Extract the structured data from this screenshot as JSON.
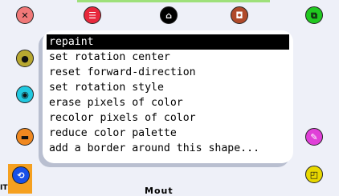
{
  "menu": {
    "items": [
      {
        "label": "repaint"
      },
      {
        "label": "set rotation center"
      },
      {
        "label": "reset forward-direction"
      },
      {
        "label": "set rotation style"
      },
      {
        "label": "erase pixels of color"
      },
      {
        "label": "recolor pixels of color"
      },
      {
        "label": "reduce color palette"
      },
      {
        "label": "add a border around this shape..."
      }
    ]
  },
  "halo": {
    "delete": {
      "glyph": "✕",
      "color": "#f07878"
    },
    "menu": {
      "glyph": "☰",
      "color": "#e8283c"
    },
    "pickup": {
      "glyph": "⌂",
      "color": "#000000"
    },
    "move": {
      "glyph": "◘",
      "color": "#b04a2a"
    },
    "duplicate": {
      "glyph": "⧉",
      "color": "#20c820"
    },
    "debug": {
      "glyph": "●",
      "color": "#b8a830"
    },
    "view": {
      "glyph": "◉",
      "color": "#20c8e0"
    },
    "collapse": {
      "glyph": "▬",
      "color": "#f08820"
    },
    "paint": {
      "glyph": "✎",
      "color": "#e040d8"
    },
    "rotate": {
      "glyph": "⟲",
      "color": "#1850e8"
    },
    "resize": {
      "glyph": "◰",
      "color": "#e8d800"
    }
  },
  "labels": {
    "corner": "IT",
    "bottom": "Mout"
  }
}
